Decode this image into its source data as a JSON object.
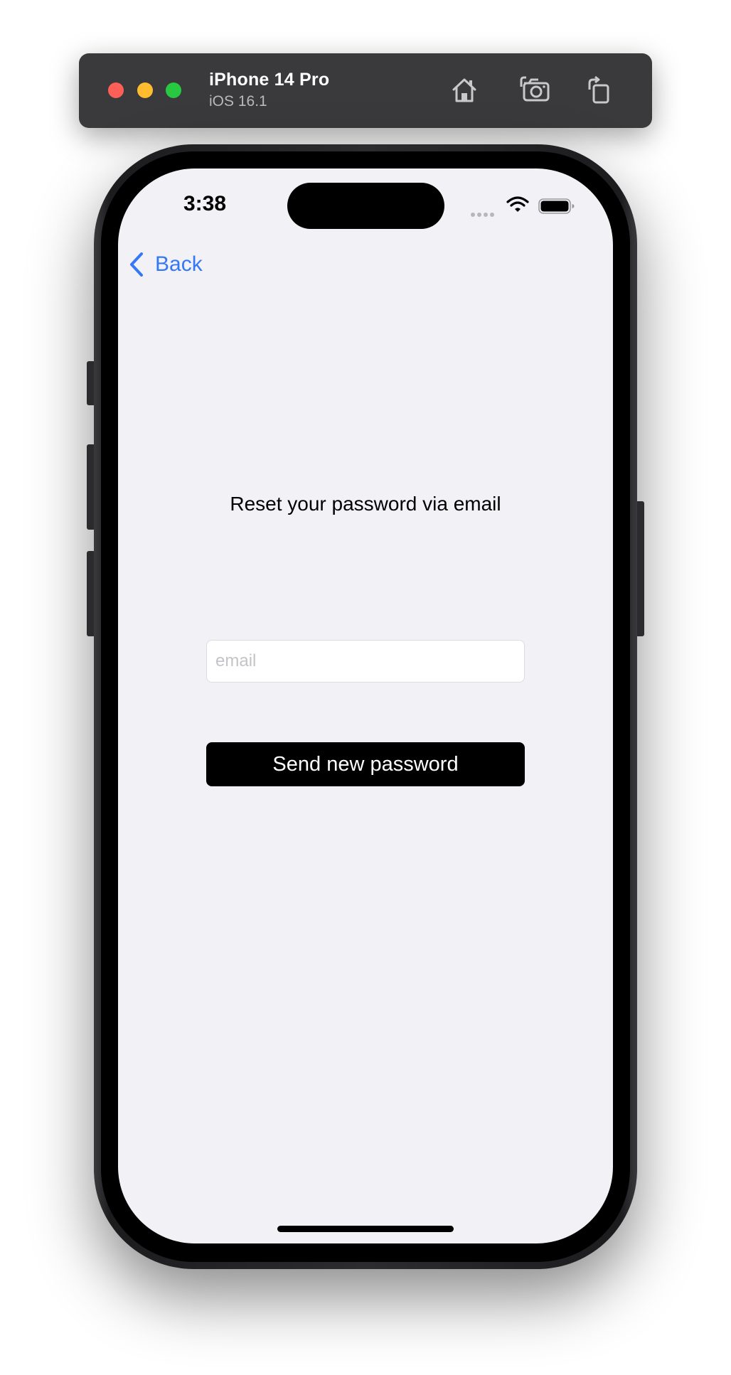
{
  "simulator": {
    "device_name": "iPhone 14 Pro",
    "os_version": "iOS 16.1",
    "icons": [
      "home-icon",
      "screenshot-icon",
      "rotate-icon"
    ]
  },
  "status_bar": {
    "time": "3:38",
    "icons": [
      "cellular-signal-icon",
      "wifi-icon",
      "battery-icon"
    ]
  },
  "nav": {
    "back_label": "Back"
  },
  "main": {
    "heading": "Reset your password via email",
    "email_placeholder": "email",
    "email_value": "",
    "send_button_label": "Send new password"
  },
  "colors": {
    "accent": "#3478f6",
    "screen_background": "#f2f1f6",
    "button_background": "#000000",
    "button_text": "#ffffff",
    "titlebar_background": "#3a393b"
  }
}
